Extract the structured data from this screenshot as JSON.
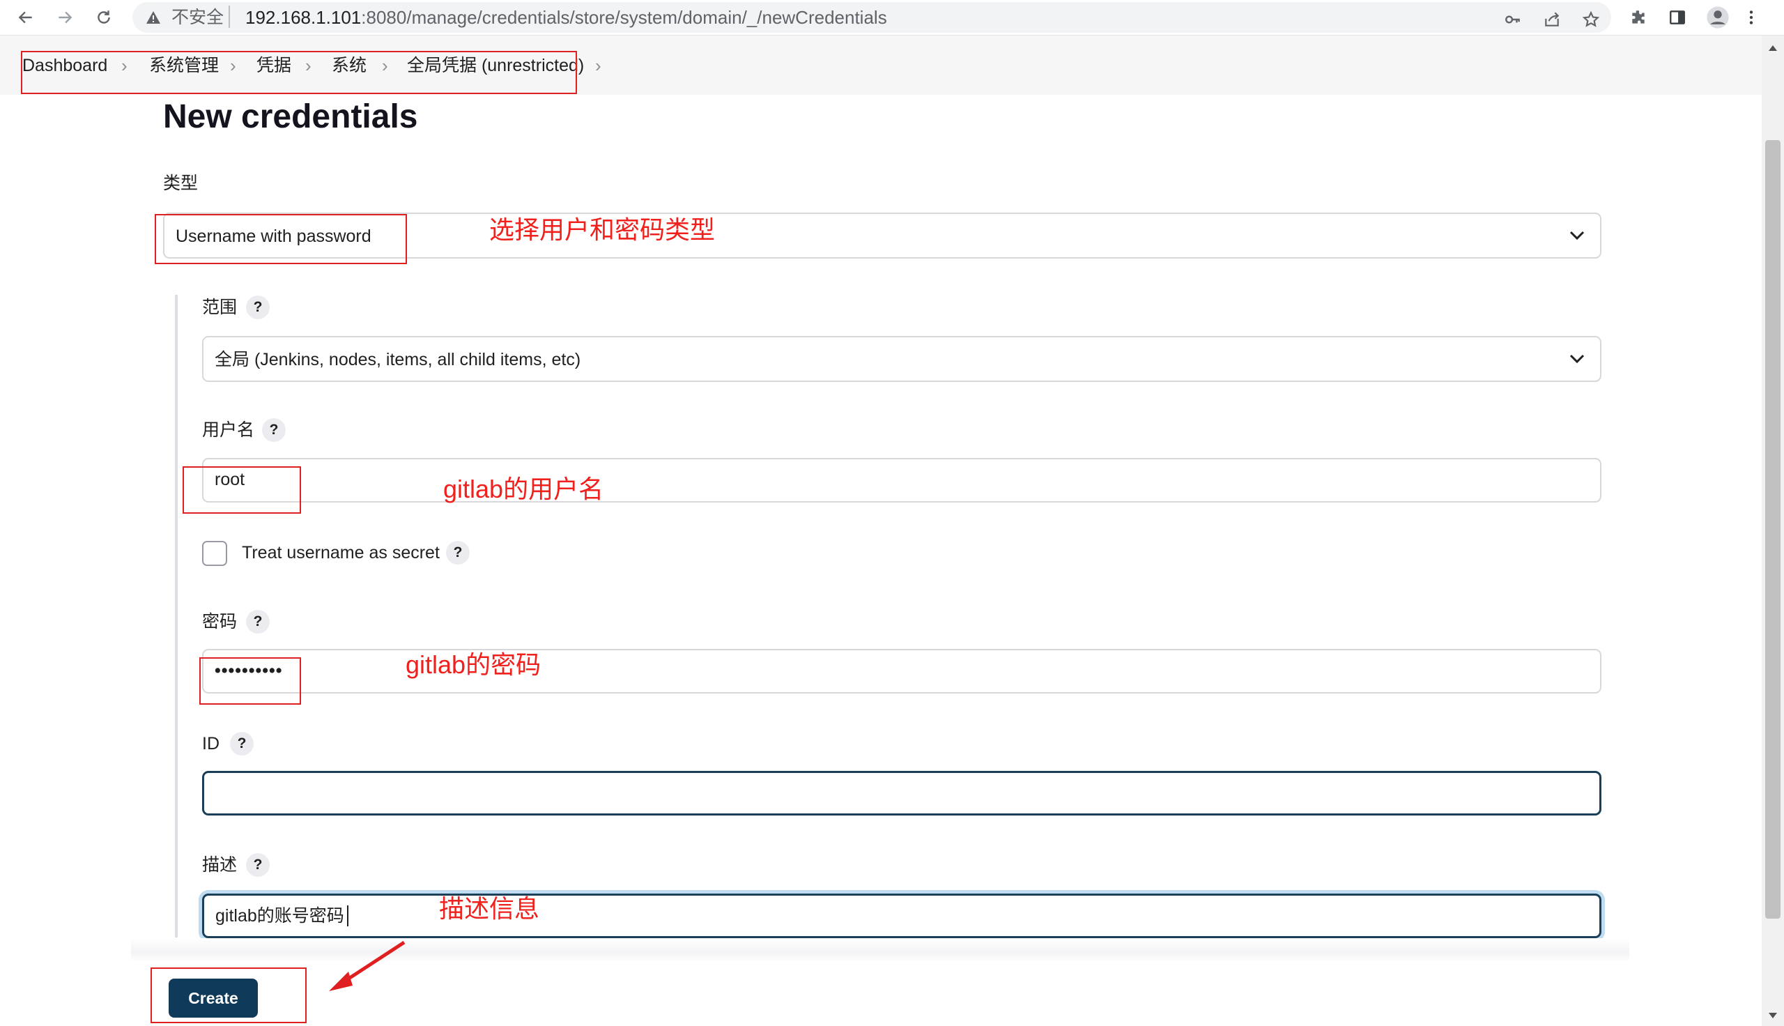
{
  "browser": {
    "insecure_label": "不安全",
    "url_host": "192.168.1.101",
    "url_rest": ":8080/manage/credentials/store/system/domain/_/newCredentials"
  },
  "breadcrumb": {
    "items": [
      "Dashboard",
      "系统管理",
      "凭据",
      "系统",
      "全局凭据 (unrestricted)"
    ]
  },
  "page": {
    "title": "New credentials"
  },
  "form": {
    "kind": {
      "label": "类型",
      "selected": "Username with password"
    },
    "scope": {
      "label": "范围",
      "selected": "全局 (Jenkins, nodes, items, all child items, etc)"
    },
    "username": {
      "label": "用户名",
      "value": "root"
    },
    "username_secret": {
      "label": "Treat username as secret",
      "checked": false
    },
    "password": {
      "label": "密码",
      "value": "••••••••••"
    },
    "id": {
      "label": "ID",
      "value": ""
    },
    "description": {
      "label": "描述",
      "value": "gitlab的账号密码"
    },
    "help_symbol": "?"
  },
  "actions": {
    "create_label": "Create"
  },
  "annotations": {
    "kind_note": "选择用户和密码类型",
    "username_note": "gitlab的用户名",
    "password_note": "gitlab的密码",
    "description_note": "描述信息"
  },
  "colors": {
    "annotation": "#e02020",
    "button": "#0f3a5a",
    "focus_border": "#1b3f58"
  },
  "icons": [
    "back-arrow-icon",
    "forward-arrow-icon",
    "reload-icon",
    "warning-icon",
    "key-icon",
    "share-icon",
    "star-icon",
    "extension-icon",
    "side-panel-icon",
    "profile-icon",
    "menu-icon",
    "chevron-down-icon"
  ]
}
